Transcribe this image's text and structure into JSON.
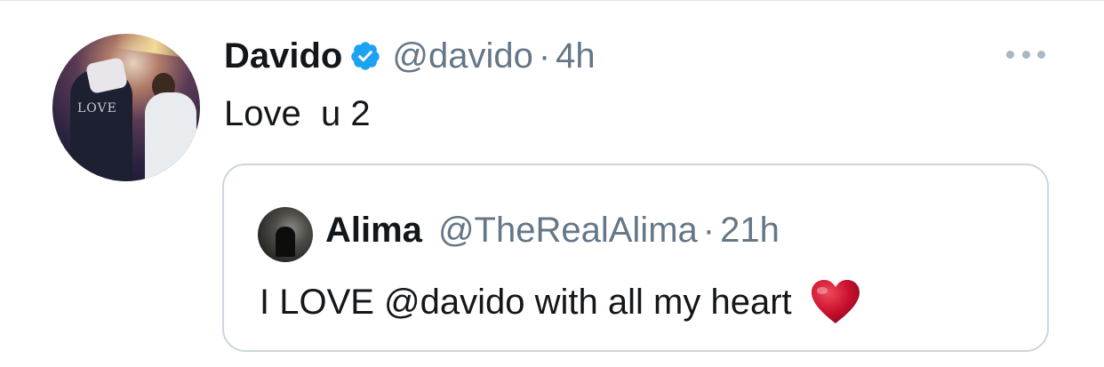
{
  "tweet": {
    "author_name": "Davido",
    "author_handle": "@davido",
    "separator": "·",
    "time": "4h",
    "text": "Love  u 2",
    "avatar_shirt_text": "LOVE",
    "verified_icon": "verified-badge-icon",
    "more_icon": "more-dots-icon"
  },
  "quote": {
    "author_name": "Alima",
    "author_handle": "@TheRealAlima",
    "separator": "·",
    "time": "21h",
    "text": "I LOVE @davido with all my heart",
    "heart_icon": "red-heart-emoji"
  },
  "colors": {
    "text_primary": "#14171a",
    "text_secondary": "#657786",
    "verified_blue": "#1da1f2",
    "border": "#ccd6dd",
    "heart_red": "#c8102e"
  }
}
